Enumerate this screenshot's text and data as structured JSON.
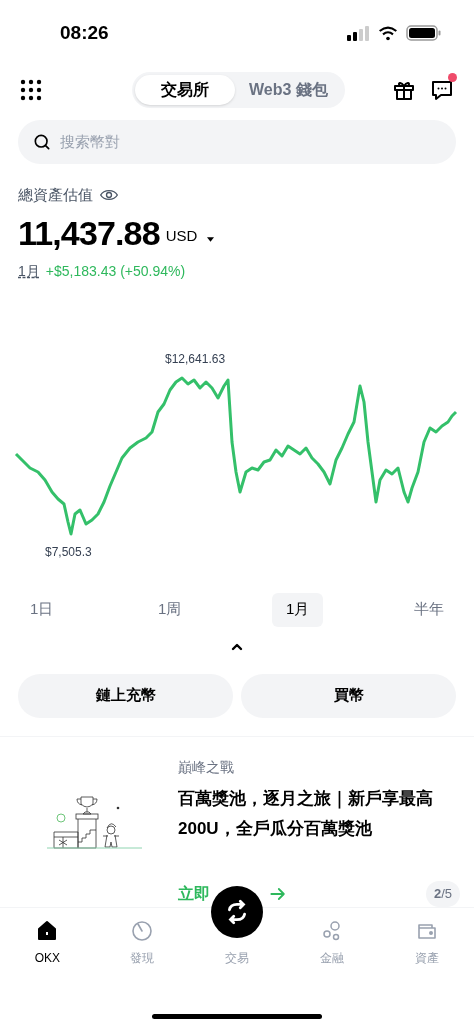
{
  "status_bar": {
    "time": "08:26"
  },
  "header": {
    "tabs": [
      {
        "label": "交易所",
        "selected": true
      },
      {
        "label": "Web3 錢包",
        "selected": false
      }
    ],
    "messages_unread": true
  },
  "search": {
    "placeholder": "搜索幣對"
  },
  "assets": {
    "label": "總資產估值",
    "value": "11,437.88",
    "currency": "USD",
    "period": "1月",
    "change": "+$5,183.43 (+50.94%)"
  },
  "chart": {
    "high_label": "$12,641.63",
    "low_label": "$7,505.3"
  },
  "periods": [
    {
      "label": "1日",
      "selected": false
    },
    {
      "label": "1周",
      "selected": false
    },
    {
      "label": "1月",
      "selected": true
    },
    {
      "label": "半年",
      "selected": false
    }
  ],
  "actions": [
    "鏈上充幣",
    "買幣"
  ],
  "banner": {
    "category": "巔峰之戰",
    "title": "百萬獎池，逐月之旅｜新戶享最高200U，全戶瓜分百萬獎池",
    "cta": "立即",
    "pager": "**2**/5"
  },
  "nav": [
    {
      "label": "OKX",
      "selected": true,
      "kind": "home"
    },
    {
      "label": "發現",
      "selected": false,
      "kind": "discover"
    },
    {
      "label": "交易",
      "selected": false,
      "kind": "trade"
    },
    {
      "label": "金融",
      "selected": false,
      "kind": "finance"
    },
    {
      "label": "資產",
      "selected": false,
      "kind": "assets"
    }
  ]
}
